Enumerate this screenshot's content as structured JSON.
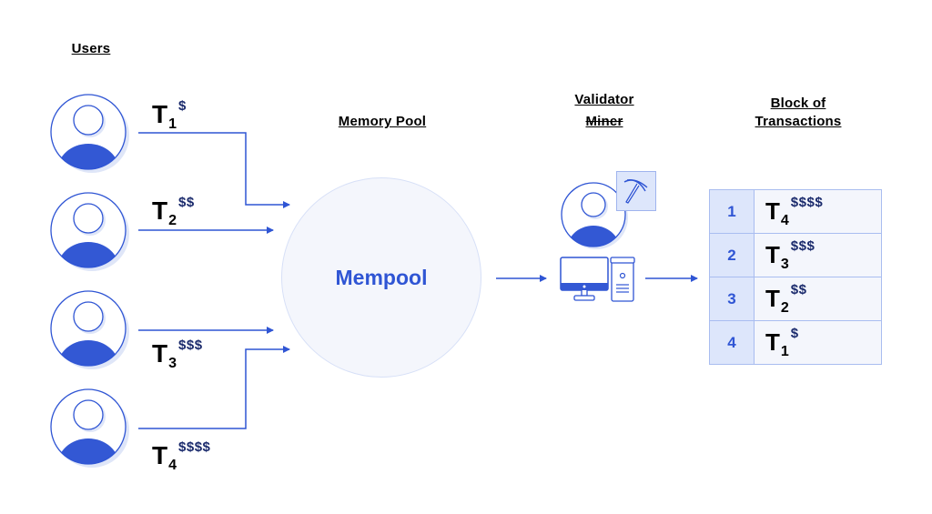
{
  "headings": {
    "users": "Users",
    "memory_pool": "Memory Pool",
    "validator": "Validator",
    "miner": "Miner",
    "block_line1": "Block of",
    "block_line2": "Transactions"
  },
  "mempool": {
    "label": "Mempool"
  },
  "users": [
    {
      "tx": "T",
      "index": "1",
      "fee": "$"
    },
    {
      "tx": "T",
      "index": "2",
      "fee": "$$"
    },
    {
      "tx": "T",
      "index": "3",
      "fee": "$$$"
    },
    {
      "tx": "T",
      "index": "4",
      "fee": "$$$$"
    }
  ],
  "block": {
    "rows": [
      {
        "order": "1",
        "tx": "T",
        "index": "4",
        "fee": "$$$$"
      },
      {
        "order": "2",
        "tx": "T",
        "index": "3",
        "fee": "$$$"
      },
      {
        "order": "3",
        "tx": "T",
        "index": "2",
        "fee": "$$"
      },
      {
        "order": "4",
        "tx": "T",
        "index": "1",
        "fee": "$"
      }
    ]
  },
  "colors": {
    "accent": "#2f55d4",
    "light_fill": "#f4f6fc",
    "header_fill": "#dde6fb",
    "fee_text": "#1a2a6c"
  }
}
